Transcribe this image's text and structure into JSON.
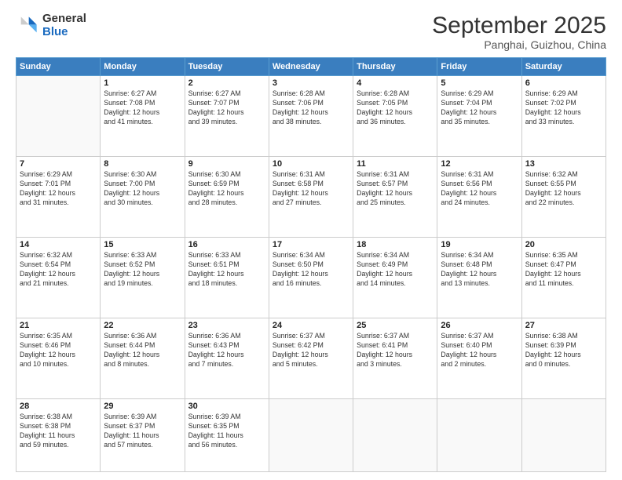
{
  "logo": {
    "general": "General",
    "blue": "Blue"
  },
  "title": "September 2025",
  "subtitle": "Panghai, Guizhou, China",
  "days": [
    "Sunday",
    "Monday",
    "Tuesday",
    "Wednesday",
    "Thursday",
    "Friday",
    "Saturday"
  ],
  "weeks": [
    [
      {
        "day": null,
        "text": ""
      },
      {
        "day": "1",
        "text": "Sunrise: 6:27 AM\nSunset: 7:08 PM\nDaylight: 12 hours\nand 41 minutes."
      },
      {
        "day": "2",
        "text": "Sunrise: 6:27 AM\nSunset: 7:07 PM\nDaylight: 12 hours\nand 39 minutes."
      },
      {
        "day": "3",
        "text": "Sunrise: 6:28 AM\nSunset: 7:06 PM\nDaylight: 12 hours\nand 38 minutes."
      },
      {
        "day": "4",
        "text": "Sunrise: 6:28 AM\nSunset: 7:05 PM\nDaylight: 12 hours\nand 36 minutes."
      },
      {
        "day": "5",
        "text": "Sunrise: 6:29 AM\nSunset: 7:04 PM\nDaylight: 12 hours\nand 35 minutes."
      },
      {
        "day": "6",
        "text": "Sunrise: 6:29 AM\nSunset: 7:02 PM\nDaylight: 12 hours\nand 33 minutes."
      }
    ],
    [
      {
        "day": "7",
        "text": "Sunrise: 6:29 AM\nSunset: 7:01 PM\nDaylight: 12 hours\nand 31 minutes."
      },
      {
        "day": "8",
        "text": "Sunrise: 6:30 AM\nSunset: 7:00 PM\nDaylight: 12 hours\nand 30 minutes."
      },
      {
        "day": "9",
        "text": "Sunrise: 6:30 AM\nSunset: 6:59 PM\nDaylight: 12 hours\nand 28 minutes."
      },
      {
        "day": "10",
        "text": "Sunrise: 6:31 AM\nSunset: 6:58 PM\nDaylight: 12 hours\nand 27 minutes."
      },
      {
        "day": "11",
        "text": "Sunrise: 6:31 AM\nSunset: 6:57 PM\nDaylight: 12 hours\nand 25 minutes."
      },
      {
        "day": "12",
        "text": "Sunrise: 6:31 AM\nSunset: 6:56 PM\nDaylight: 12 hours\nand 24 minutes."
      },
      {
        "day": "13",
        "text": "Sunrise: 6:32 AM\nSunset: 6:55 PM\nDaylight: 12 hours\nand 22 minutes."
      }
    ],
    [
      {
        "day": "14",
        "text": "Sunrise: 6:32 AM\nSunset: 6:54 PM\nDaylight: 12 hours\nand 21 minutes."
      },
      {
        "day": "15",
        "text": "Sunrise: 6:33 AM\nSunset: 6:52 PM\nDaylight: 12 hours\nand 19 minutes."
      },
      {
        "day": "16",
        "text": "Sunrise: 6:33 AM\nSunset: 6:51 PM\nDaylight: 12 hours\nand 18 minutes."
      },
      {
        "day": "17",
        "text": "Sunrise: 6:34 AM\nSunset: 6:50 PM\nDaylight: 12 hours\nand 16 minutes."
      },
      {
        "day": "18",
        "text": "Sunrise: 6:34 AM\nSunset: 6:49 PM\nDaylight: 12 hours\nand 14 minutes."
      },
      {
        "day": "19",
        "text": "Sunrise: 6:34 AM\nSunset: 6:48 PM\nDaylight: 12 hours\nand 13 minutes."
      },
      {
        "day": "20",
        "text": "Sunrise: 6:35 AM\nSunset: 6:47 PM\nDaylight: 12 hours\nand 11 minutes."
      }
    ],
    [
      {
        "day": "21",
        "text": "Sunrise: 6:35 AM\nSunset: 6:46 PM\nDaylight: 12 hours\nand 10 minutes."
      },
      {
        "day": "22",
        "text": "Sunrise: 6:36 AM\nSunset: 6:44 PM\nDaylight: 12 hours\nand 8 minutes."
      },
      {
        "day": "23",
        "text": "Sunrise: 6:36 AM\nSunset: 6:43 PM\nDaylight: 12 hours\nand 7 minutes."
      },
      {
        "day": "24",
        "text": "Sunrise: 6:37 AM\nSunset: 6:42 PM\nDaylight: 12 hours\nand 5 minutes."
      },
      {
        "day": "25",
        "text": "Sunrise: 6:37 AM\nSunset: 6:41 PM\nDaylight: 12 hours\nand 3 minutes."
      },
      {
        "day": "26",
        "text": "Sunrise: 6:37 AM\nSunset: 6:40 PM\nDaylight: 12 hours\nand 2 minutes."
      },
      {
        "day": "27",
        "text": "Sunrise: 6:38 AM\nSunset: 6:39 PM\nDaylight: 12 hours\nand 0 minutes."
      }
    ],
    [
      {
        "day": "28",
        "text": "Sunrise: 6:38 AM\nSunset: 6:38 PM\nDaylight: 11 hours\nand 59 minutes."
      },
      {
        "day": "29",
        "text": "Sunrise: 6:39 AM\nSunset: 6:37 PM\nDaylight: 11 hours\nand 57 minutes."
      },
      {
        "day": "30",
        "text": "Sunrise: 6:39 AM\nSunset: 6:35 PM\nDaylight: 11 hours\nand 56 minutes."
      },
      {
        "day": null,
        "text": ""
      },
      {
        "day": null,
        "text": ""
      },
      {
        "day": null,
        "text": ""
      },
      {
        "day": null,
        "text": ""
      }
    ]
  ]
}
